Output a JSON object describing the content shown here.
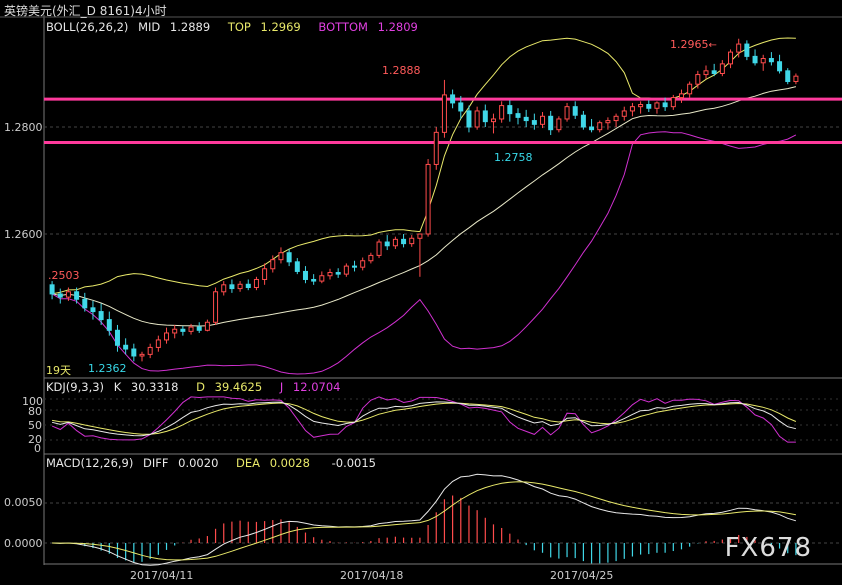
{
  "window": {
    "title": "英镑美元(外汇_D 8161)4小时"
  },
  "boll": {
    "name": "BOLL(26,26,2)",
    "mid_label": "MID",
    "mid_value": "1.2889",
    "top_label": "TOP",
    "top_value": "1.2969",
    "bottom_label": "BOTTOM",
    "bottom_value": "1.2809"
  },
  "kdj": {
    "name": "KDJ(9,3,3)",
    "k_label": "K",
    "k_value": "30.3318",
    "d_label": "D",
    "d_value": "39.4625",
    "j_label": "J",
    "j_value": "12.0704"
  },
  "macd": {
    "name": "MACD(12,26,9)",
    "diff_label": "DIFF",
    "diff_value": "0.0020",
    "dea_label": "DEA",
    "dea_value": "0.0028",
    "hist_value": "-0.0015"
  },
  "price_axis": [
    "1.2800",
    "1.2600"
  ],
  "kdj_axis": [
    "100",
    "80",
    "50",
    "20",
    "0"
  ],
  "macd_axis": [
    "0.0050",
    "0.0000"
  ],
  "date_axis": [
    "2017/04/11",
    "2017/04/18",
    "2017/04/25"
  ],
  "annotations": {
    "high_label": "1.2965",
    "spike_label": "1.2888",
    "low_label": "1.2362",
    "left_label": ".2503",
    "support_label": "1.2758",
    "period_label": "19天"
  },
  "logo": "FX678",
  "colors": {
    "up": "#ff4c4c",
    "down": "#40d8e8",
    "mid": "#e8e8c8",
    "top": "#e8e86a",
    "bottom": "#d030d0",
    "level_line": "#ff3a9c",
    "k": "#e8e8e8",
    "d": "#e8e86a",
    "j": "#d030d0"
  },
  "levels": [
    1.2852,
    1.2771
  ],
  "chart_data": {
    "type": "candlestick",
    "title": "英镑美元(外汇_D 8161)4小时",
    "x_ticks": [
      "2017/04/11",
      "2017/04/18",
      "2017/04/25"
    ],
    "y_ticks": [
      1.26,
      1.28
    ],
    "candles": [
      [
        1.2505,
        1.2512,
        1.2478,
        1.2488
      ],
      [
        1.2488,
        1.2498,
        1.247,
        1.2482
      ],
      [
        1.2482,
        1.25,
        1.2475,
        1.2492
      ],
      [
        1.2492,
        1.25,
        1.247,
        1.2478
      ],
      [
        1.2478,
        1.249,
        1.2455,
        1.2462
      ],
      [
        1.2462,
        1.2475,
        1.244,
        1.2455
      ],
      [
        1.2455,
        1.247,
        1.243,
        1.244
      ],
      [
        1.244,
        1.2455,
        1.241,
        1.242
      ],
      [
        1.242,
        1.243,
        1.238,
        1.2392
      ],
      [
        1.2392,
        1.2405,
        1.2375,
        1.2385
      ],
      [
        1.2385,
        1.2395,
        1.2362,
        1.2372
      ],
      [
        1.2372,
        1.238,
        1.2362,
        1.2375
      ],
      [
        1.2375,
        1.2395,
        1.2368,
        1.2388
      ],
      [
        1.2388,
        1.241,
        1.238,
        1.2402
      ],
      [
        1.2402,
        1.2425,
        1.2395,
        1.2415
      ],
      [
        1.2415,
        1.243,
        1.2405,
        1.2422
      ],
      [
        1.2422,
        1.2428,
        1.241,
        1.2418
      ],
      [
        1.2418,
        1.2432,
        1.2412,
        1.2426
      ],
      [
        1.2426,
        1.2435,
        1.2415,
        1.242
      ],
      [
        1.242,
        1.244,
        1.2418,
        1.2435
      ],
      [
        1.2435,
        1.25,
        1.243,
        1.2492
      ],
      [
        1.2492,
        1.2512,
        1.2485,
        1.2505
      ],
      [
        1.2505,
        1.2515,
        1.249,
        1.2498
      ],
      [
        1.2498,
        1.2512,
        1.2492,
        1.2506
      ],
      [
        1.2506,
        1.2515,
        1.2495,
        1.25
      ],
      [
        1.25,
        1.252,
        1.2495,
        1.2515
      ],
      [
        1.2515,
        1.2545,
        1.2505,
        1.2535
      ],
      [
        1.2535,
        1.256,
        1.2528,
        1.2552
      ],
      [
        1.2552,
        1.2575,
        1.2545,
        1.2565
      ],
      [
        1.2565,
        1.2572,
        1.254,
        1.2548
      ],
      [
        1.2548,
        1.2555,
        1.2525,
        1.253
      ],
      [
        1.253,
        1.254,
        1.2508,
        1.2515
      ],
      [
        1.2515,
        1.2525,
        1.2505,
        1.2512
      ],
      [
        1.2512,
        1.253,
        1.2508,
        1.2522
      ],
      [
        1.2522,
        1.2535,
        1.2515,
        1.2528
      ],
      [
        1.2528,
        1.2536,
        1.2518,
        1.2525
      ],
      [
        1.2525,
        1.2545,
        1.252,
        1.254
      ],
      [
        1.254,
        1.255,
        1.253,
        1.2538
      ],
      [
        1.2538,
        1.2556,
        1.2532,
        1.255
      ],
      [
        1.255,
        1.2565,
        1.2545,
        1.256
      ],
      [
        1.256,
        1.259,
        1.2555,
        1.2585
      ],
      [
        1.2585,
        1.2598,
        1.257,
        1.2578
      ],
      [
        1.2578,
        1.2595,
        1.2572,
        1.259
      ],
      [
        1.259,
        1.26,
        1.2575,
        1.2582
      ],
      [
        1.2582,
        1.2598,
        1.2576,
        1.2592
      ],
      [
        1.2592,
        1.26,
        1.252,
        1.26
      ],
      [
        1.26,
        1.274,
        1.2595,
        1.273
      ],
      [
        1.273,
        1.28,
        1.272,
        1.279
      ],
      [
        1.279,
        1.2888,
        1.278,
        1.286
      ],
      [
        1.286,
        1.287,
        1.2835,
        1.2845
      ],
      [
        1.2845,
        1.2858,
        1.2815,
        1.283
      ],
      [
        1.283,
        1.284,
        1.279,
        1.28
      ],
      [
        1.28,
        1.2838,
        1.2795,
        1.283
      ],
      [
        1.283,
        1.2842,
        1.28,
        1.281
      ],
      [
        1.281,
        1.2825,
        1.2788,
        1.2815
      ],
      [
        1.2815,
        1.2848,
        1.2808,
        1.284
      ],
      [
        1.284,
        1.285,
        1.281,
        1.2825
      ],
      [
        1.2825,
        1.2835,
        1.2805,
        1.2818
      ],
      [
        1.2818,
        1.2832,
        1.28,
        1.2812
      ],
      [
        1.2812,
        1.2825,
        1.2795,
        1.2805
      ],
      [
        1.2805,
        1.2828,
        1.2798,
        1.282
      ],
      [
        1.282,
        1.283,
        1.2785,
        1.2795
      ],
      [
        1.2795,
        1.282,
        1.279,
        1.2815
      ],
      [
        1.2815,
        1.2845,
        1.281,
        1.2838
      ],
      [
        1.2838,
        1.2848,
        1.2815,
        1.2822
      ],
      [
        1.2822,
        1.283,
        1.2795,
        1.28
      ],
      [
        1.28,
        1.2815,
        1.279,
        1.2795
      ],
      [
        1.2795,
        1.2812,
        1.279,
        1.2808
      ],
      [
        1.2808,
        1.2818,
        1.2795,
        1.2812
      ],
      [
        1.2812,
        1.2825,
        1.28,
        1.282
      ],
      [
        1.282,
        1.2838,
        1.2812,
        1.283
      ],
      [
        1.283,
        1.2845,
        1.282,
        1.2838
      ],
      [
        1.2838,
        1.2848,
        1.2825,
        1.2842
      ],
      [
        1.2842,
        1.285,
        1.2828,
        1.2835
      ],
      [
        1.2835,
        1.2848,
        1.2825,
        1.2845
      ],
      [
        1.2845,
        1.2855,
        1.283,
        1.2838
      ],
      [
        1.2838,
        1.286,
        1.2832,
        1.2855
      ],
      [
        1.2855,
        1.287,
        1.2845,
        1.2862
      ],
      [
        1.2862,
        1.2885,
        1.2855,
        1.288
      ],
      [
        1.288,
        1.2905,
        1.2872,
        1.2898
      ],
      [
        1.2898,
        1.2915,
        1.289,
        1.2905
      ],
      [
        1.2905,
        1.2918,
        1.2895,
        1.29
      ],
      [
        1.29,
        1.2925,
        1.2895,
        1.2918
      ],
      [
        1.2918,
        1.2945,
        1.291,
        1.294
      ],
      [
        1.294,
        1.2965,
        1.293,
        1.2955
      ],
      [
        1.2955,
        1.2962,
        1.2925,
        1.2932
      ],
      [
        1.2932,
        1.2945,
        1.2915,
        1.292
      ],
      [
        1.292,
        1.2935,
        1.2905,
        1.2928
      ],
      [
        1.2928,
        1.294,
        1.2915,
        1.2922
      ],
      [
        1.2922,
        1.2935,
        1.29,
        1.2905
      ],
      [
        1.2905,
        1.291,
        1.288,
        1.2885
      ],
      [
        1.2885,
        1.29,
        1.288,
        1.2895
      ]
    ]
  }
}
